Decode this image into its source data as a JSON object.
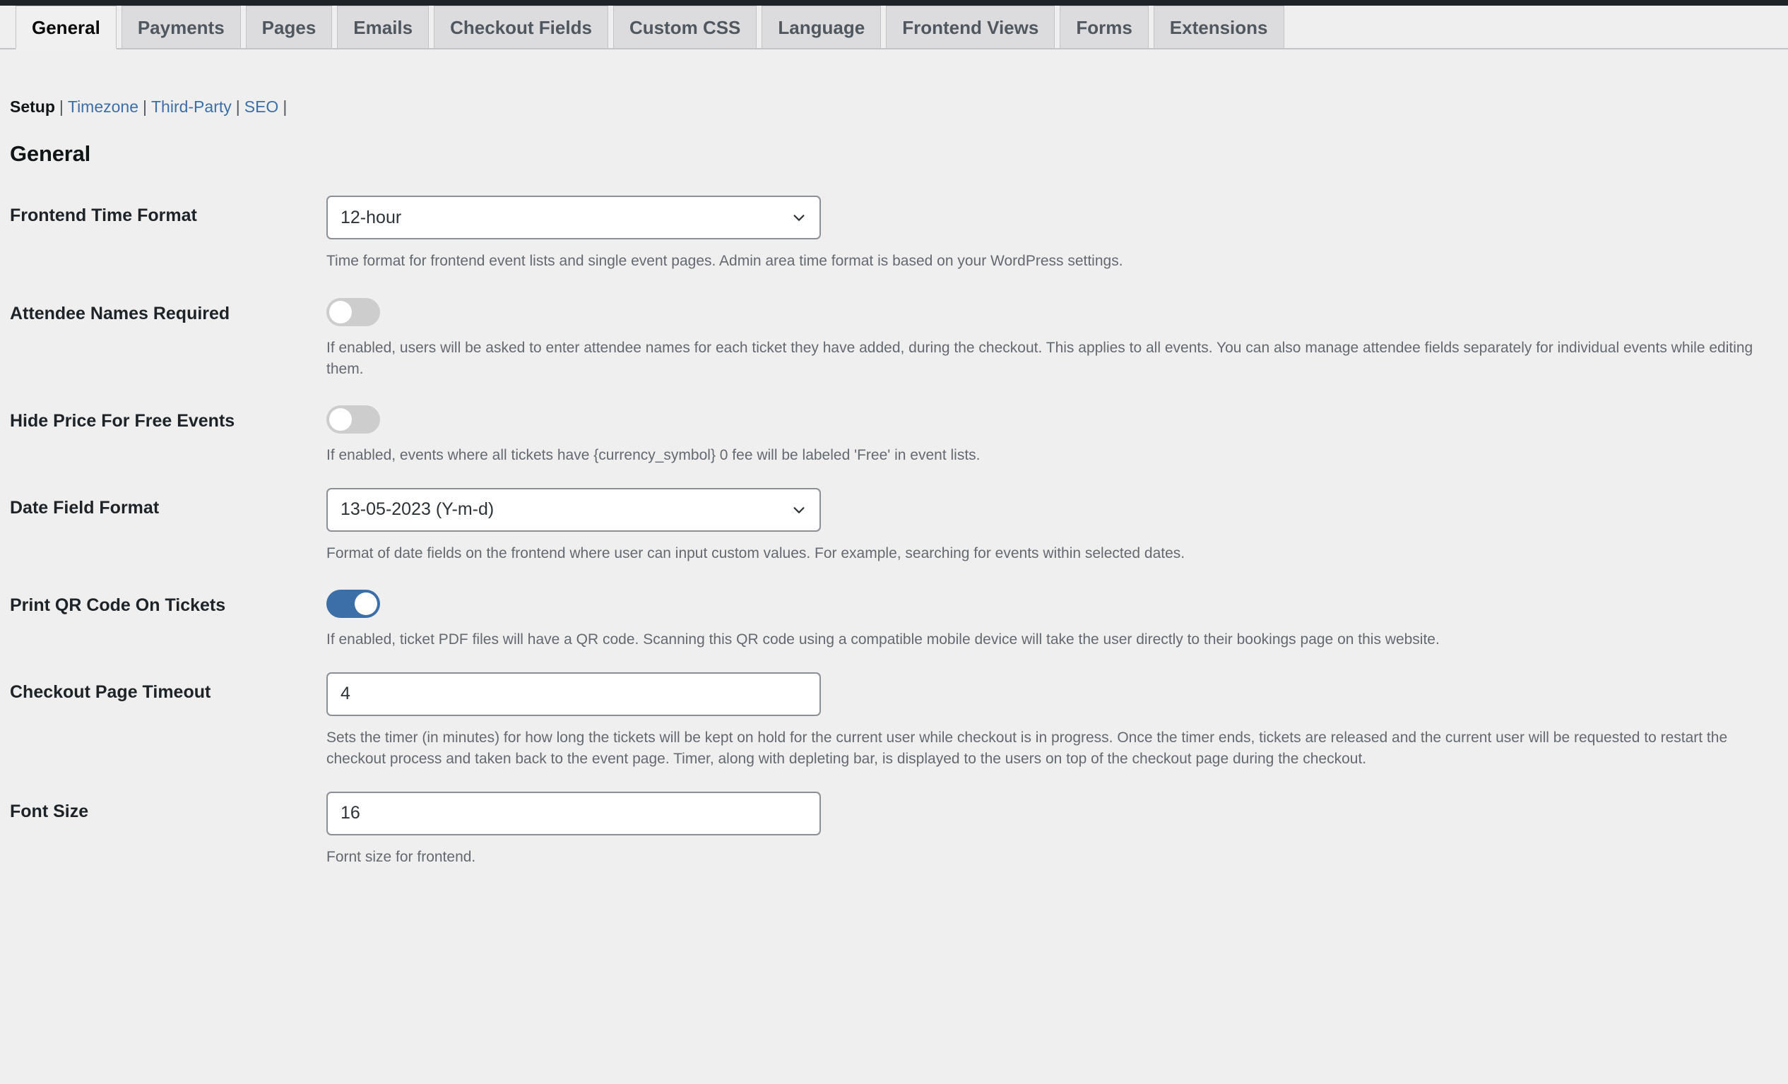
{
  "tabs": [
    {
      "label": "General",
      "active": true
    },
    {
      "label": "Payments",
      "active": false
    },
    {
      "label": "Pages",
      "active": false
    },
    {
      "label": "Emails",
      "active": false
    },
    {
      "label": "Checkout Fields",
      "active": false
    },
    {
      "label": "Custom CSS",
      "active": false
    },
    {
      "label": "Language",
      "active": false
    },
    {
      "label": "Frontend Views",
      "active": false
    },
    {
      "label": "Forms",
      "active": false
    },
    {
      "label": "Extensions",
      "active": false
    }
  ],
  "subnav": {
    "current": "Setup",
    "links": [
      "Timezone",
      "Third-Party",
      "SEO"
    ],
    "separator": "|"
  },
  "section": {
    "title": "General"
  },
  "fields": {
    "frontend_time_format": {
      "label": "Frontend Time Format",
      "value": "12-hour",
      "description": "Time format for frontend event lists and single event pages. Admin area time format is based on your WordPress settings."
    },
    "attendee_names_required": {
      "label": "Attendee Names Required",
      "state": "off",
      "description": "If enabled, users will be asked to enter attendee names for each ticket they have added, during the checkout. This applies to all events. You can also manage attendee fields separately for individual events while editing them."
    },
    "hide_price_free_events": {
      "label": "Hide Price For Free Events",
      "state": "off",
      "description": "If enabled, events where all tickets have {currency_symbol} 0 fee will be labeled 'Free' in event lists."
    },
    "date_field_format": {
      "label": "Date Field Format",
      "value": "13-05-2023 (Y-m-d)",
      "description": "Format of date fields on the frontend where user can input custom values. For example, searching for events within selected dates."
    },
    "print_qr_code": {
      "label": "Print QR Code On Tickets",
      "state": "on",
      "description": "If enabled, ticket PDF files will have a QR code. Scanning this QR code using a compatible mobile device will take the user directly to their bookings page on this website."
    },
    "checkout_page_timeout": {
      "label": "Checkout Page Timeout",
      "value": "4",
      "description": "Sets the timer (in minutes) for how long the tickets will be kept on hold for the current user while checkout is in progress. Once the timer ends, tickets are released and the current user will be requested to restart the checkout process and taken back to the event page. Timer, along with depleting bar, is displayed to the users on top of the checkout page during the checkout."
    },
    "font_size": {
      "label": "Font Size",
      "value": "16",
      "description": "Fornt size for frontend."
    }
  },
  "colors": {
    "accent_blue": "#3c6fa8",
    "link_blue": "#3c6fa8",
    "page_bg": "#efefef",
    "tab_inactive_bg": "#dcdcde",
    "toggle_off": "#cdcdcd",
    "text_dark": "#1d2327",
    "text_muted": "#646970",
    "border": "#8c8f94"
  }
}
